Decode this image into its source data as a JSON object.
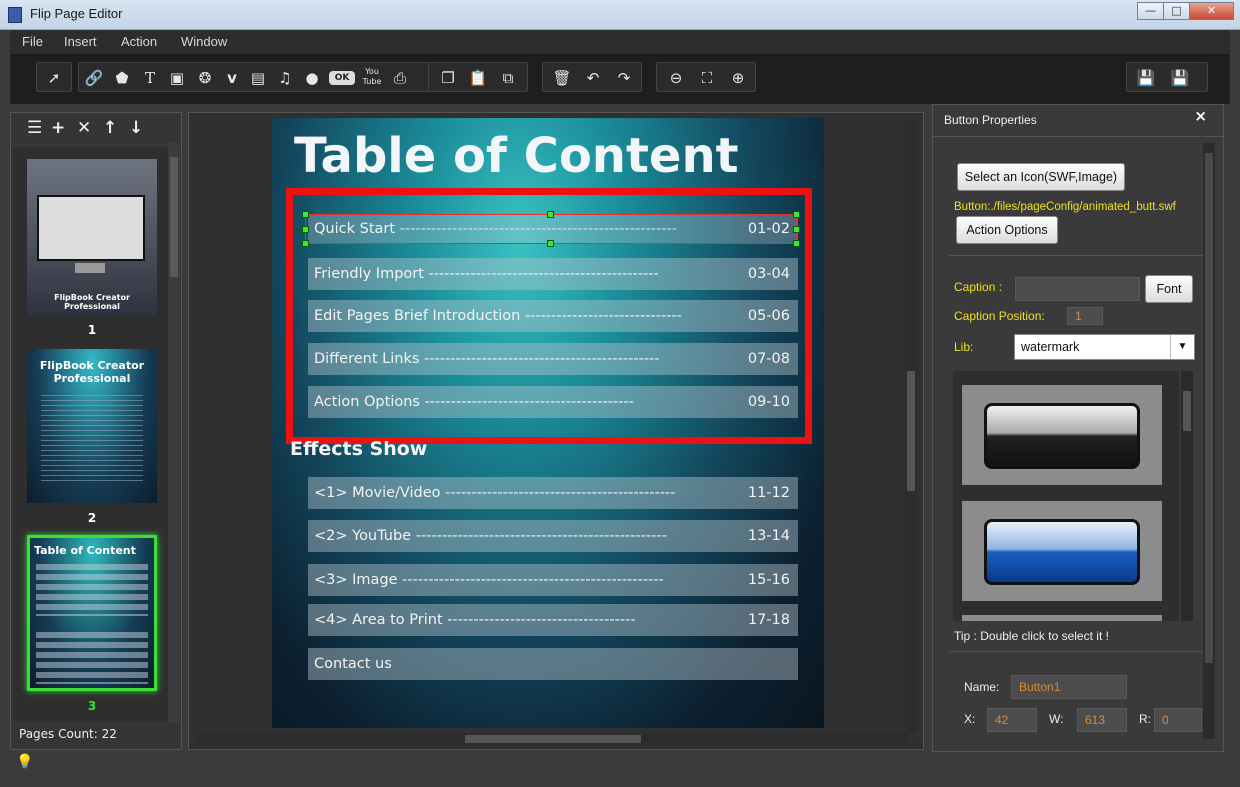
{
  "window": {
    "title": "Flip Page Editor",
    "min": "—",
    "max": "□",
    "close": "✕"
  },
  "menu": [
    "File",
    "Insert",
    "Action",
    "Window"
  ],
  "toolbar": {
    "tools": [
      "select-tool-icon",
      "link-icon",
      "shape-icon",
      "text-icon",
      "image-icon",
      "swf-icon",
      "vimeo-icon",
      "video-icon",
      "audio-icon",
      "flash-icon",
      "button-icon",
      "youtube-icon",
      "print-icon",
      "copy-icon",
      "paste-icon",
      "duplicate-icon",
      "delete-icon",
      "undo-icon",
      "redo-icon",
      "zoom-out-icon",
      "fit-icon",
      "zoom-in-icon",
      "save-icon",
      "save-as-icon"
    ],
    "ok_label": "OK",
    "youtube_label": "You Tube"
  },
  "left_panel": {
    "thumbs": [
      {
        "num": "1",
        "caption": "FlipBook Creator Professional"
      },
      {
        "num": "2",
        "title": "FlipBook Creator Professional"
      },
      {
        "num": "3",
        "title": "Table of Content"
      }
    ],
    "pages_count": "Pages Count: 22"
  },
  "page": {
    "title": "Table of Content",
    "toc": [
      {
        "label": "Quick Start",
        "pages": "01-02"
      },
      {
        "label": "Friendly Import",
        "pages": "03-04"
      },
      {
        "label": "Edit Pages Brief Introduction",
        "pages": "05-06"
      },
      {
        "label": "Different Links",
        "pages": "07-08"
      },
      {
        "label": "Action Options",
        "pages": "09-10"
      }
    ],
    "effects_title": "Effects Show",
    "effects": [
      {
        "label": "<1> Movie/Video",
        "pages": "11-12"
      },
      {
        "label": "<2> YouTube",
        "pages": "13-14"
      },
      {
        "label": "<3> Image",
        "pages": "15-16"
      },
      {
        "label": "<4> Area to Print",
        "pages": "17-18"
      },
      {
        "label": "Contact us",
        "pages": ""
      }
    ]
  },
  "props": {
    "title": "Button Properties",
    "select_icon_btn": "Select an Icon(SWF,Image)",
    "button_path": "Button:./files/pageConfig/animated_butt.swf",
    "action_options_btn": "Action Options",
    "caption_label": "Caption :",
    "caption_value": "",
    "font_btn": "Font",
    "caption_position_label": "Caption Position:",
    "caption_position_value": "1",
    "lib_label": "Lib:",
    "lib_value": "watermark",
    "tip": "Tip : Double click to select it !",
    "name_label": "Name:",
    "name_value": "Button1",
    "x_label": "X:",
    "x_value": "42",
    "w_label": "W:",
    "w_value": "613",
    "r_label": "R:",
    "r_value": "0"
  }
}
